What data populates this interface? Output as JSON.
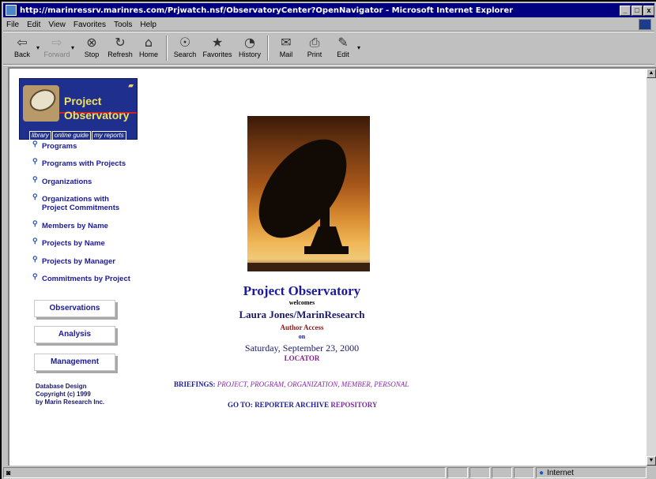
{
  "window": {
    "title": "http://marinressrv.marinres.com/Prjwatch.nsf/ObservatoryCenter?OpenNavigator - Microsoft Internet Explorer",
    "controls": {
      "minimize": "_",
      "maximize": "□",
      "close": "x"
    }
  },
  "menu": [
    "File",
    "Edit",
    "View",
    "Favorites",
    "Tools",
    "Help"
  ],
  "toolbar": [
    {
      "label": "Back",
      "icon": "back-arrow-icon",
      "glyph": "⇦"
    },
    {
      "label": "Forward",
      "icon": "forward-arrow-icon",
      "glyph": "⇨"
    },
    {
      "label": "Stop",
      "icon": "stop-icon",
      "glyph": "⊗"
    },
    {
      "label": "Refresh",
      "icon": "refresh-icon",
      "glyph": "↻"
    },
    {
      "label": "Home",
      "icon": "home-icon",
      "glyph": "⌂"
    },
    {
      "label": "Search",
      "icon": "search-icon",
      "glyph": "☉"
    },
    {
      "label": "Favorites",
      "icon": "favorites-icon",
      "glyph": "★"
    },
    {
      "label": "History",
      "icon": "history-icon",
      "glyph": "◔"
    },
    {
      "label": "Mail",
      "icon": "mail-icon",
      "glyph": "✉"
    },
    {
      "label": "Print",
      "icon": "print-icon",
      "glyph": "⎙"
    },
    {
      "label": "Edit",
      "icon": "edit-icon",
      "glyph": "✎"
    }
  ],
  "logo": {
    "line1": "Project",
    "line2": "Observatory",
    "tabs": [
      "library",
      "online guide",
      "my reports"
    ]
  },
  "nav": [
    "Programs",
    "Programs with Projects",
    "Organizations",
    "Organizations with Project Commitments",
    "Members by Name",
    "Projects by Name",
    "Projects by Manager",
    "Commitments by Project"
  ],
  "section_buttons": [
    "Observations",
    "Analysis",
    "Management"
  ],
  "footer": {
    "line1": "Database Design",
    "line2": "Copyright (c) 1999",
    "line3": "by Marin Research Inc."
  },
  "main": {
    "title": "Project Observatory",
    "welcomes": "welcomes",
    "user": "Laura Jones/MarinResearch",
    "access": "Author Access",
    "on": "on",
    "date": "Saturday, September 23, 2000",
    "locator": "LOCATOR",
    "briefings_label": "BRIEFINGS:",
    "briefings_links": "PROJECT, PROGRAM, ORGANIZATION, MEMBER, PERSONAL",
    "goto_label": "GO TO:",
    "goto_link1": "REPORTER ARCHIVE",
    "goto_link2": "REPOSITORY"
  },
  "status": {
    "zone": "Internet"
  }
}
